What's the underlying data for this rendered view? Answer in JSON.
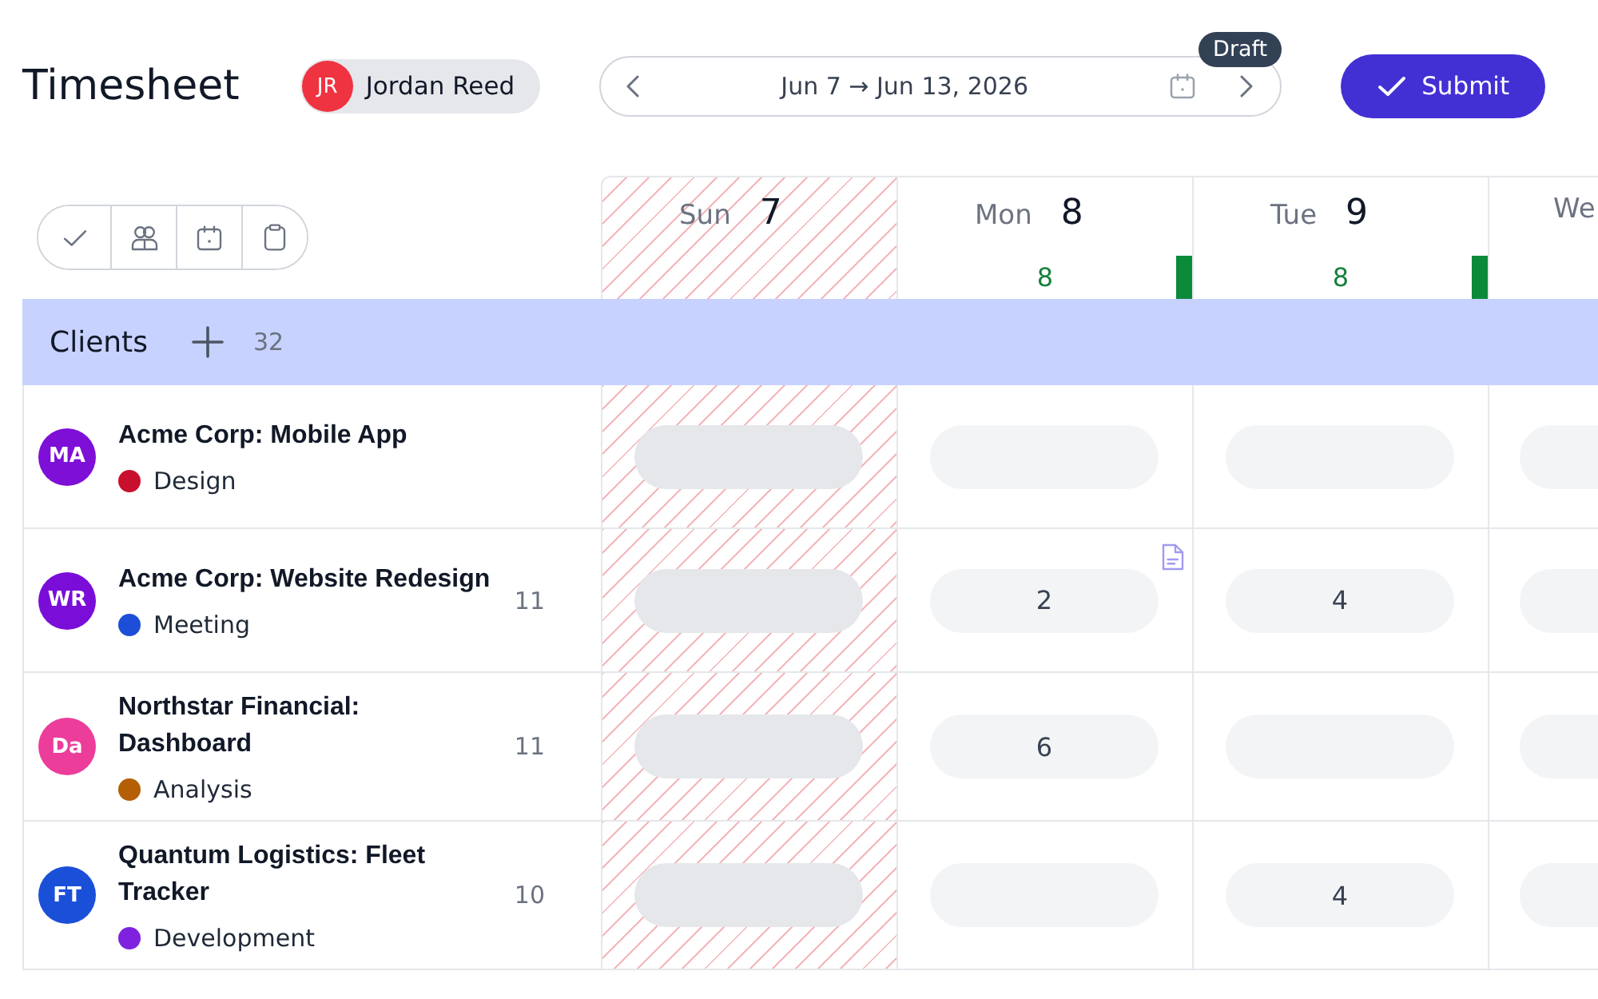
{
  "header": {
    "title": "Timesheet",
    "user": {
      "initials": "JR",
      "name": "Jordan Reed"
    },
    "date_range": "Jun 7 → Jun 13, 2026",
    "status": "Draft",
    "submit_label": "Submit"
  },
  "days": [
    {
      "name": "Sun",
      "date": "7",
      "weekend": true,
      "complete": false
    },
    {
      "name": "Mon",
      "date": "8",
      "total": "8",
      "weekend": false,
      "complete": true
    },
    {
      "name": "Tue",
      "date": "9",
      "total": "8",
      "weekend": false,
      "complete": true
    },
    {
      "name": "We",
      "weekend": false,
      "complete": false
    }
  ],
  "group": {
    "label": "Clients",
    "count": "32"
  },
  "rows": [
    {
      "avatar": {
        "initials": "MA",
        "color": "#7e0fd6"
      },
      "title": "Acme Corp: Mobile App",
      "category": {
        "label": "Design",
        "color": "#c8102e"
      },
      "cells": [
        {
          "disabled": true,
          "has_note": false
        },
        {
          "disabled": false,
          "has_note": false
        },
        {
          "disabled": false,
          "has_note": false
        },
        {
          "disabled": false,
          "has_note": false
        }
      ]
    },
    {
      "avatar": {
        "initials": "WR",
        "color": "#7a0ed8"
      },
      "title": "Acme Corp: Website Redesign",
      "category": {
        "label": "Meeting",
        "color": "#1d4ed8"
      },
      "total": "11",
      "cells": [
        {
          "disabled": true,
          "has_note": false
        },
        {
          "value": "2",
          "disabled": false,
          "has_note": true
        },
        {
          "value": "4",
          "disabled": false,
          "has_note": false
        },
        {
          "disabled": false,
          "has_note": false
        }
      ]
    },
    {
      "avatar": {
        "initials": "Da",
        "color": "#ec3d9b"
      },
      "title": "Northstar Financial: Dashboard",
      "category": {
        "label": "Analysis",
        "color": "#b45f06"
      },
      "total": "11",
      "cells": [
        {
          "disabled": true,
          "has_note": false
        },
        {
          "value": "6",
          "disabled": false,
          "has_note": false
        },
        {
          "disabled": false,
          "has_note": false
        },
        {
          "disabled": false,
          "has_note": false
        }
      ]
    },
    {
      "avatar": {
        "initials": "FT",
        "color": "#1a4fd8"
      },
      "title": "Quantum Logistics: Fleet Tracker",
      "category": {
        "label": "Development",
        "color": "#7e22e0"
      },
      "total": "10",
      "cells": [
        {
          "disabled": true,
          "has_note": false
        },
        {
          "disabled": false,
          "has_note": false
        },
        {
          "value": "4",
          "disabled": false,
          "has_note": false
        },
        {
          "disabled": false,
          "has_note": false
        }
      ]
    }
  ]
}
